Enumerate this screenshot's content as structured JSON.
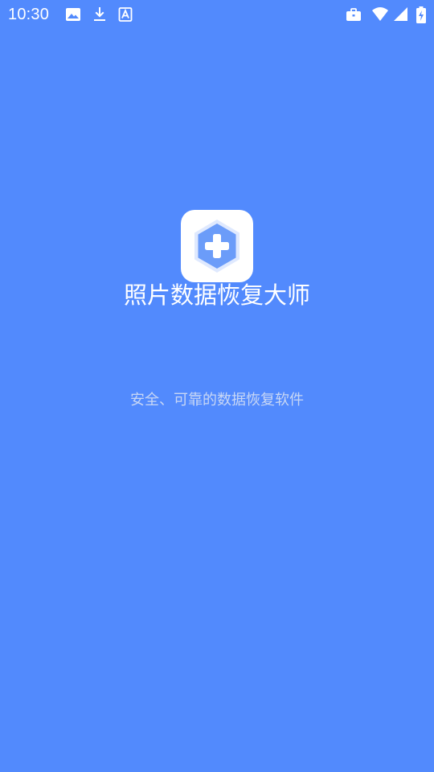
{
  "colors": {
    "background": "#528afd",
    "status_text": "#ffffff",
    "icon_tile": "#ffffff",
    "icon_hexagon": "#6b9cf9",
    "icon_hexagon_light": "#dfe9fe",
    "slogan": "#c8d7f5"
  },
  "status_bar": {
    "time": "10:30",
    "left_icons": [
      "image-icon",
      "download-icon",
      "font-icon"
    ],
    "right_icons": [
      "briefcase-icon",
      "wifi-icon",
      "cell-signal-icon",
      "battery-charging-icon"
    ]
  },
  "splash": {
    "app_icon": "medical-plus-hexagon-icon",
    "title": "照片数据恢复大师",
    "slogan": "安全、可靠的数据恢复软件"
  }
}
